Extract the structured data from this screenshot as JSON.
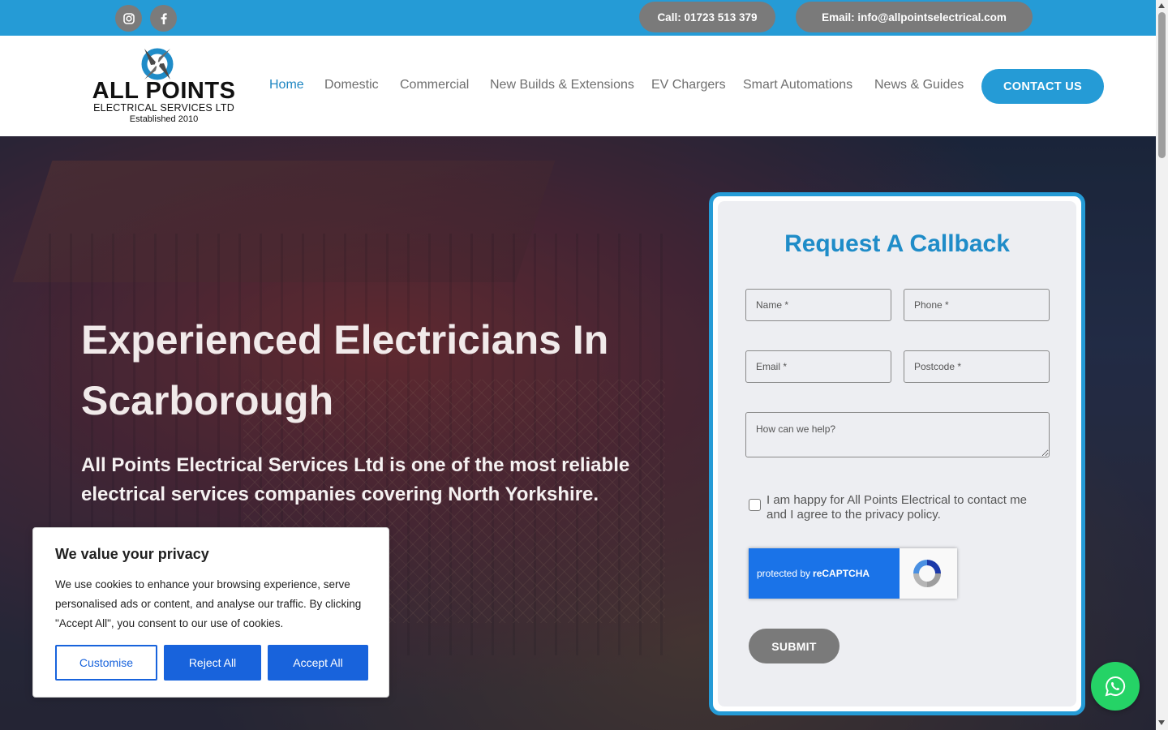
{
  "topbar": {
    "social": [
      {
        "icon": "instagram-icon"
      },
      {
        "icon": "facebook-icon"
      }
    ],
    "call_label": "Call: 01723 513 379",
    "email_label": "Email: info@allpointselectrical.com"
  },
  "logo": {
    "title": "ALL POINTS",
    "subtitle": "ELECTRICAL SERVICES LTD",
    "established": "Established 2010"
  },
  "nav": {
    "items": [
      {
        "label": "Home",
        "active": true
      },
      {
        "label": "Domestic",
        "active": false
      },
      {
        "label": "Commercial",
        "active": false
      },
      {
        "label": "New Builds & Extensions",
        "active": false
      },
      {
        "label": "EV Chargers",
        "active": false
      },
      {
        "label": "Smart Automations",
        "active": false
      },
      {
        "label": "News & Guides",
        "active": false
      }
    ],
    "contact_label": "CONTACT US"
  },
  "hero": {
    "title": "Experienced Electricians In Scarborough",
    "subtitle": "All Points Electrical Services Ltd is one of the most reliable electrical services companies covering North Yorkshire."
  },
  "form": {
    "title": "Request A Callback",
    "name_placeholder": "Name *",
    "phone_placeholder": "Phone *",
    "email_placeholder": "Email *",
    "postcode_placeholder": "Postcode *",
    "message_placeholder": "How can we help?",
    "consent_text": "I am happy for All Points Electrical to contact me and I agree to the privacy policy.",
    "captcha_prefix": "protected by",
    "captcha_brand": "reCAPTCHA",
    "submit_label": "SUBMIT"
  },
  "cookie": {
    "title": "We value your privacy",
    "text": "We use cookies to enhance your browsing experience, serve personalised ads or content, and analyse our traffic. By clicking \"Accept All\", you consent to our use of cookies.",
    "customise_label": "Customise",
    "reject_label": "Reject All",
    "accept_label": "Accept All"
  },
  "colors": {
    "brand_blue": "#259bd6",
    "title_blue": "#1f8cc8",
    "pill_gray": "#7a7a7a",
    "cookie_blue": "#1863dc",
    "whatsapp_green": "#25d366"
  }
}
